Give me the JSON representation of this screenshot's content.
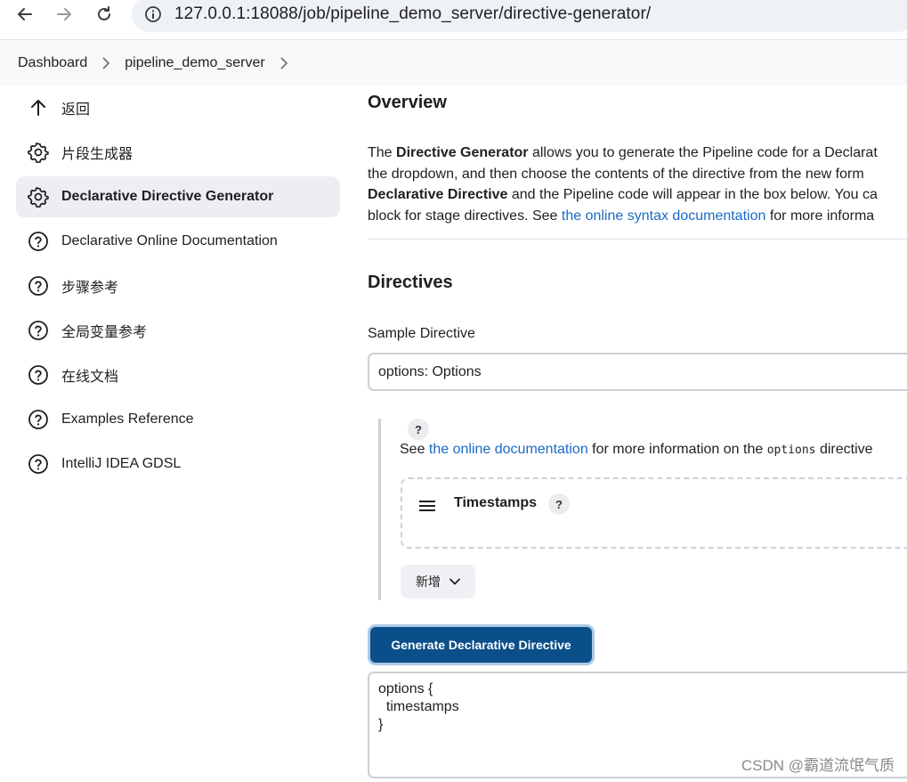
{
  "browser": {
    "url": "127.0.0.1:18088/job/pipeline_demo_server/directive-generator/"
  },
  "breadcrumb": {
    "items": [
      "Dashboard",
      "pipeline_demo_server"
    ]
  },
  "sidebar": {
    "items": [
      {
        "label": "返回",
        "icon": "arrow-up-icon"
      },
      {
        "label": "片段生成器",
        "icon": "gear-icon"
      },
      {
        "label": "Declarative Directive Generator",
        "icon": "gear-icon",
        "active": true
      },
      {
        "label": "Declarative Online Documentation",
        "icon": "help-circle-icon"
      },
      {
        "label": "步骤参考",
        "icon": "help-circle-icon"
      },
      {
        "label": "全局变量参考",
        "icon": "help-circle-icon"
      },
      {
        "label": "在线文档",
        "icon": "help-circle-icon"
      },
      {
        "label": "Examples Reference",
        "icon": "help-circle-icon"
      },
      {
        "label": "IntelliJ IDEA GDSL",
        "icon": "help-circle-icon"
      }
    ]
  },
  "main": {
    "overview_title": "Overview",
    "overview": {
      "p1_pre": "The ",
      "p1_bold": "Directive Generator",
      "p1_post": " allows you to generate the Pipeline code for a Declarat",
      "p2": "the dropdown, and then choose the contents of the directive from the new form",
      "p3_bold": "Declarative Directive",
      "p3_post": " and the Pipeline code will appear in the box below. You ca",
      "p4_pre": "block for stage directives. See ",
      "p4_link": "the online syntax documentation",
      "p4_post": " for more informa"
    },
    "directives_title": "Directives",
    "sample_label": "Sample Directive",
    "sample_value": "options: Options",
    "config": {
      "help": "?",
      "see_pre": "See ",
      "see_link": "the online documentation",
      "see_mid": " for more information on the ",
      "see_code": "options",
      "see_post": " directive",
      "timestamps_label": "Timestamps",
      "timestamps_help": "?",
      "add_label": "新增"
    },
    "generate_button": "Generate Declarative Directive",
    "code_output": "options {\n  timestamps\n}"
  },
  "watermark": "CSDN @霸道流氓气质",
  "colors": {
    "link": "#1a6bc4",
    "primary_button": "#0b4f8a",
    "active_sidebar": "#eceef4"
  }
}
